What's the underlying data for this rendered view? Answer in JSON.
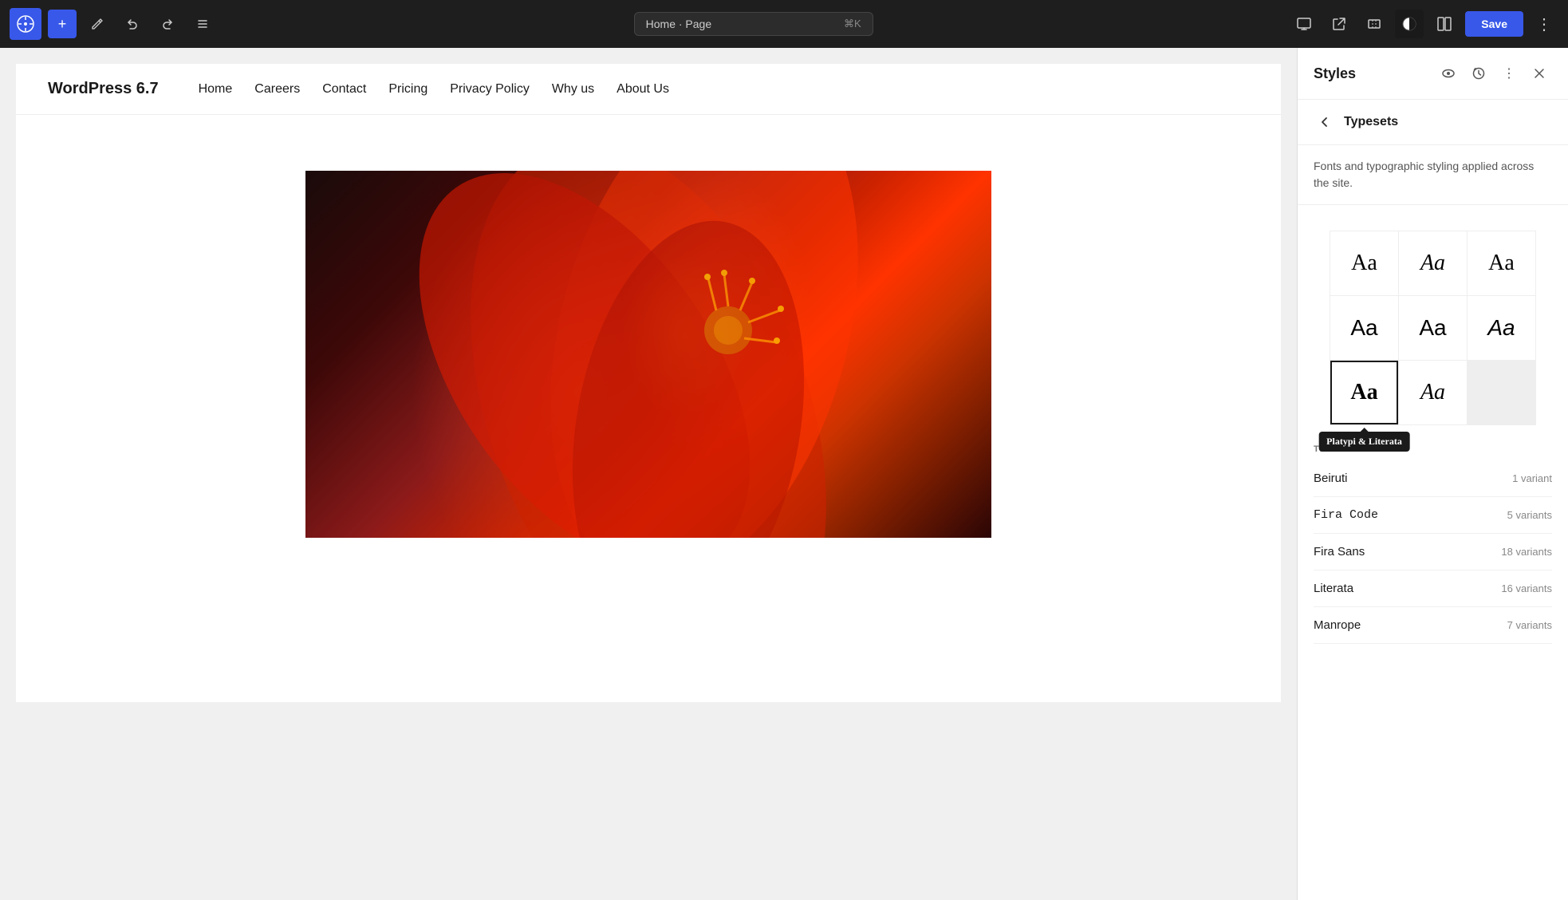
{
  "toolbar": {
    "wp_logo": "W",
    "add_label": "+",
    "edit_label": "✏",
    "undo_label": "↩",
    "redo_label": "↪",
    "list_label": "☰",
    "search_text": "Home · Page",
    "shortcut": "⌘K",
    "desktop_icon": "🖥",
    "external_icon": "⬡",
    "resize_icon": "⊡",
    "contrast_icon": "◑",
    "sidebar_icon": "⊞",
    "save_label": "Save",
    "more_icon": "⋮"
  },
  "page": {
    "logo": "WordPress 6.7",
    "nav_links": [
      "Home",
      "Careers",
      "Contact",
      "Pricing",
      "Privacy Policy",
      "Why us",
      "About Us"
    ]
  },
  "styles_panel": {
    "title": "Styles",
    "eye_icon": "👁",
    "history_icon": "⟳",
    "more_icon": "⋮",
    "close_icon": "✕"
  },
  "typesets": {
    "title": "Typesets",
    "description": "Fonts and typographic styling applied across the site.",
    "font_cells": [
      {
        "label": "Aa",
        "style": "serif-1"
      },
      {
        "label": "Aa",
        "style": "serif-2"
      },
      {
        "label": "Aa",
        "style": "serif-3"
      },
      {
        "label": "Aa",
        "style": "sans-1"
      },
      {
        "label": "Aa",
        "style": "sans-2"
      },
      {
        "label": "Aa",
        "style": "sans-3"
      },
      {
        "label": "Aa",
        "style": "platypi",
        "selected": true
      },
      {
        "label": "Aa",
        "style": "literata"
      }
    ],
    "tooltip": "Platypi & Literata",
    "theme_label": "THEME",
    "fonts": [
      {
        "name": "Beiruti",
        "variants": "1 variant",
        "code": false
      },
      {
        "name": "Fira Code",
        "variants": "5 variants",
        "code": true
      },
      {
        "name": "Fira Sans",
        "variants": "18 variants",
        "code": false
      },
      {
        "name": "Literata",
        "variants": "16 variants",
        "code": false
      },
      {
        "name": "Manrope",
        "variants": "7 variants",
        "code": false
      }
    ]
  }
}
